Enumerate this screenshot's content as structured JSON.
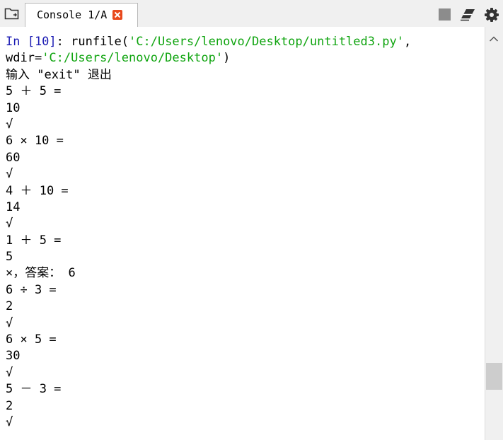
{
  "tab": {
    "label": "Console 1/A"
  },
  "icons": {
    "browse": "folder-browse-icon",
    "close": "close-icon",
    "stop": "stop-icon",
    "clear": "eraser-icon",
    "options": "gear-icon",
    "scroll_up": "chevron-up-icon"
  },
  "colors": {
    "prompt": "#1c1cb4",
    "string": "#11a511",
    "close_button": "#e8491d",
    "stop_button": "#8c8c8c"
  },
  "console": {
    "prompt": "In [10]",
    "prompt_suffix": ": runfile(",
    "runfile_path": "'C:/Users/lenovo/Desktop/untitled3.py'",
    "runfile_sep": ",",
    "wdir_prefix": "wdir=",
    "wdir_path": "'C:/Users/lenovo/Desktop'",
    "wdir_suffix": ")",
    "lines": [
      "输入 \"exit\" 退出",
      "5 ＋ 5 =",
      "10",
      "√",
      "6 × 10 =",
      "60",
      "√",
      "4 ＋ 10 =",
      "14",
      "√",
      "1 ＋ 5 =",
      "5",
      "×，答案： 6",
      "6 ÷ 3 =",
      "2",
      "√",
      "6 × 5 =",
      "30",
      "√",
      "5 － 3 =",
      "2",
      "√"
    ]
  }
}
